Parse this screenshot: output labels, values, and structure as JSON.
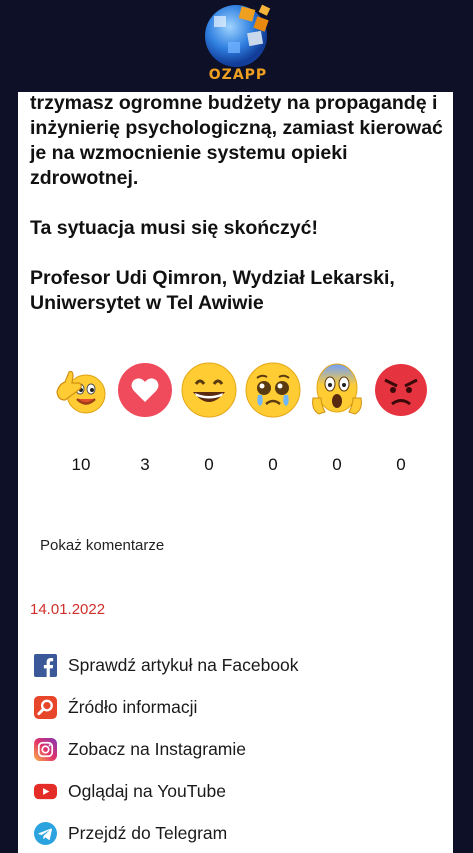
{
  "header": {
    "logo_text": "OZAPP"
  },
  "article": {
    "paragraphs": [
      "trzymasz ogromne budżety na propagandę i inżynierię psychologiczną, zamiast kierować je na wzmocnienie systemu opieki zdrowotnej.",
      "Ta sytuacja musi się skończyć!",
      "Profesor Udi Qimron, Wydział Lekarski, Uniwersytet w Tel Awiwie"
    ]
  },
  "reactions": [
    {
      "icon": "thumbs-up-emoji-icon",
      "count": "10"
    },
    {
      "icon": "heart-icon",
      "count": "3"
    },
    {
      "icon": "grinning-face-icon",
      "count": "0"
    },
    {
      "icon": "pleading-face-icon",
      "count": "0"
    },
    {
      "icon": "screaming-face-icon",
      "count": "0"
    },
    {
      "icon": "angry-face-icon",
      "count": "0"
    }
  ],
  "comments": {
    "show_label": "Pokaż komentarze"
  },
  "date": "14.01.2022",
  "links": [
    {
      "icon": "facebook-icon",
      "label": "Sprawdź artykuł na Facebook",
      "color": "#3b5998"
    },
    {
      "icon": "source-search-icon",
      "label": "Źródło informacji",
      "color": "#e8462a"
    },
    {
      "icon": "instagram-icon",
      "label": "Zobacz na Instagramie",
      "color": "#d6249f"
    },
    {
      "icon": "youtube-icon",
      "label": "Oglądaj na YouTube",
      "color": "#e52d27"
    },
    {
      "icon": "telegram-icon",
      "label": "Przejdź do Telegram",
      "color": "#2aa3df"
    }
  ],
  "colors": {
    "background": "#0d1027",
    "card": "#ffffff",
    "date": "#d0302a",
    "logo_text": "#f0a020"
  }
}
